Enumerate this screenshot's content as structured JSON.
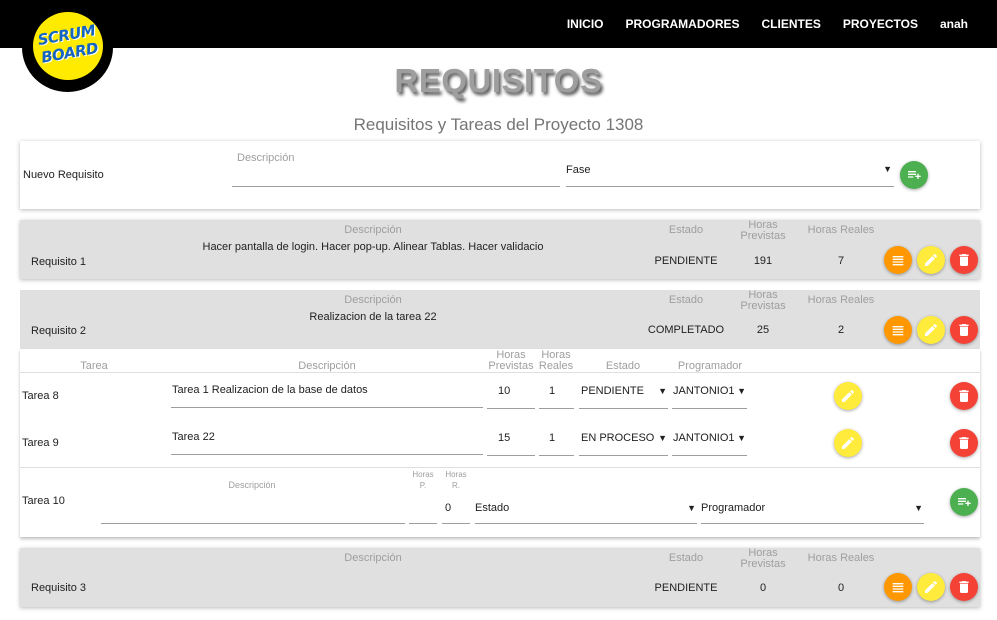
{
  "nav": {
    "links": [
      "INICIO",
      "PROGRAMADORES",
      "CLIENTES",
      "PROYECTOS",
      "anah"
    ],
    "logo_line1": "SCRUM",
    "logo_line2": "BOARD"
  },
  "page": {
    "title": "REQUISITOS",
    "subtitle": "Requisitos y Tareas del Proyecto 1308"
  },
  "new_requirement": {
    "label": "Nuevo Requisito",
    "description_label": "Descripción",
    "description_value": "",
    "phase_value": "Fase"
  },
  "columns": {
    "description": "Descripción",
    "state": "Estado",
    "planned_hours": "Horas Previstas",
    "real_hours": "Horas Reales"
  },
  "requirements": [
    {
      "name": "Requisito 1",
      "description": "Hacer pantalla de login. Hacer pop-up. Alinear Tablas. Hacer validacio",
      "state": "PENDIENTE",
      "planned": "191",
      "real": "7"
    },
    {
      "name": "Requisito 2",
      "description": "Realizacion de la tarea 22",
      "state": "COMPLETADO",
      "planned": "25",
      "real": "2"
    },
    {
      "name": "Requisito 3",
      "description": "",
      "state": "PENDIENTE",
      "planned": "0",
      "real": "0"
    }
  ],
  "task_columns": {
    "task": "Tarea",
    "description": "Descripción",
    "planned_hours": "Horas Previstas",
    "real_hours": "Horas Reales",
    "state": "Estado",
    "programmer": "Programador"
  },
  "tasks": [
    {
      "name": "Tarea 8",
      "description": "Tarea 1 Realizacion de la base de datos",
      "planned": "10",
      "real": "1",
      "state": "PENDIENTE",
      "programmer": "JANTONIO1"
    },
    {
      "name": "Tarea 9",
      "description": "Tarea 22",
      "planned": "15",
      "real": "1",
      "state": "EN PROCESO",
      "programmer": "JANTONIO1"
    }
  ],
  "new_task": {
    "name": "Tarea 10",
    "description_label": "Descripción",
    "hours_p_label": "Horas P.",
    "hours_r_label": "Horas R.",
    "planned_value": "",
    "real_value": "0",
    "state_placeholder": "Estado",
    "programmer_placeholder": "Programador"
  },
  "colors": {
    "navbar": "#000000",
    "logo_yellow": "#ffeb00",
    "logo_blue": "#1565c0",
    "fab_orange": "#ff9800",
    "fab_yellow": "#ffeb3b",
    "fab_red": "#f44336",
    "fab_green": "#4caf50",
    "card_gray": "#e0e0e0"
  },
  "icons": {
    "list": "list-icon",
    "edit": "pencil-icon",
    "delete": "trash-icon",
    "add": "playlist-add-icon",
    "dropdown": "caret-down-icon"
  }
}
